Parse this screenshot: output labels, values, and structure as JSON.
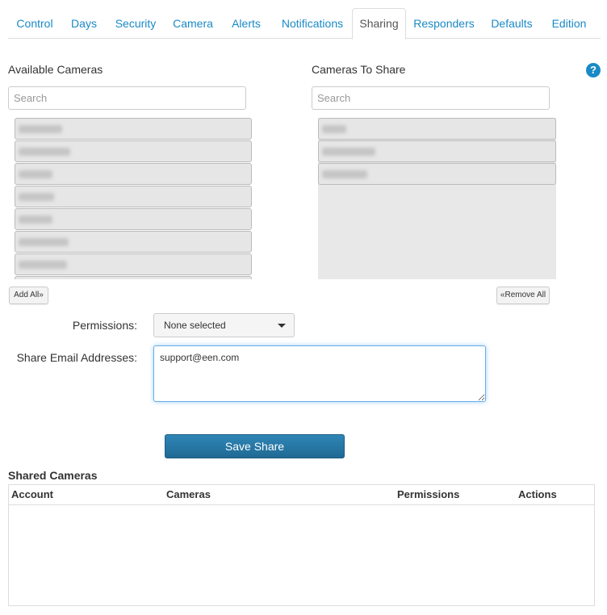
{
  "tabs": [
    {
      "label": "Control",
      "active": false
    },
    {
      "label": "Days",
      "active": false
    },
    {
      "label": "Security",
      "active": false
    },
    {
      "label": "Camera",
      "active": false
    },
    {
      "label": "Alerts",
      "active": false
    },
    {
      "label": "Notifications",
      "active": false
    },
    {
      "label": "Sharing",
      "active": true
    },
    {
      "label": "Responders",
      "active": false
    },
    {
      "label": "Defaults",
      "active": false
    },
    {
      "label": "Edition",
      "active": false
    }
  ],
  "available": {
    "title": "Available Cameras",
    "search_placeholder": "Search",
    "add_all_label": "Add All»",
    "items_count_visible": 7
  },
  "to_share": {
    "title": "Cameras To Share",
    "search_placeholder": "Search",
    "remove_all_label": "«Remove All",
    "items_count_visible": 3
  },
  "help_icon": "question-circle-icon",
  "form": {
    "permissions_label": "Permissions:",
    "permissions_value": "None selected",
    "emails_label": "Share Email Addresses:",
    "emails_value": "support@een.com",
    "save_label": "Save Share"
  },
  "shared": {
    "title": "Shared Cameras",
    "columns": [
      "Account",
      "Cameras",
      "Permissions",
      "Actions"
    ]
  },
  "colors": {
    "accent": "#1a8ac6",
    "primary_button": "#2677a5"
  }
}
